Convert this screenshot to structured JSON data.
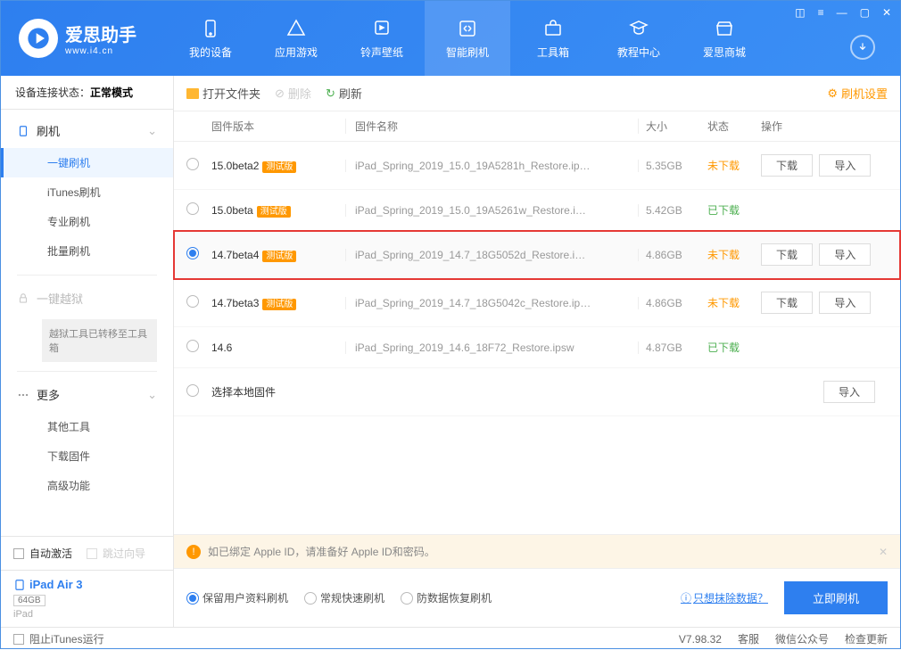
{
  "brand": {
    "name": "爱思助手",
    "url": "www.i4.cn"
  },
  "nav": {
    "items": [
      {
        "label": "我的设备"
      },
      {
        "label": "应用游戏"
      },
      {
        "label": "铃声壁纸"
      },
      {
        "label": "智能刷机"
      },
      {
        "label": "工具箱"
      },
      {
        "label": "教程中心"
      },
      {
        "label": "爱思商城"
      }
    ]
  },
  "status": {
    "prefix": "设备连接状态：",
    "value": "正常模式"
  },
  "sidebar": {
    "flash": {
      "title": "刷机",
      "items": [
        "一键刷机",
        "iTunes刷机",
        "专业刷机",
        "批量刷机"
      ]
    },
    "jailbreak": {
      "title": "一键越狱",
      "note": "越狱工具已转移至工具箱"
    },
    "more": {
      "title": "更多",
      "items": [
        "其他工具",
        "下载固件",
        "高级功能"
      ]
    },
    "auto_activate": "自动激活",
    "skip_guide": "跳过向导",
    "device": {
      "name": "iPad Air 3",
      "capacity": "64GB",
      "type": "iPad"
    },
    "block_itunes": "阻止iTunes运行"
  },
  "toolbar": {
    "open": "打开文件夹",
    "delete": "删除",
    "refresh": "刷新",
    "settings": "刷机设置"
  },
  "table": {
    "headers": {
      "version": "固件版本",
      "name": "固件名称",
      "size": "大小",
      "status": "状态",
      "ops": "操作"
    },
    "beta_tag": "测试版",
    "btns": {
      "download": "下载",
      "import": "导入"
    },
    "status_text": {
      "no": "未下载",
      "yes": "已下载"
    },
    "local": "选择本地固件",
    "rows": [
      {
        "ver": "15.0beta2",
        "beta": true,
        "name": "iPad_Spring_2019_15.0_19A5281h_Restore.ip…",
        "size": "5.35GB",
        "status": "no",
        "selected": false,
        "dl": true,
        "imp": true
      },
      {
        "ver": "15.0beta",
        "beta": true,
        "name": "iPad_Spring_2019_15.0_19A5261w_Restore.i…",
        "size": "5.42GB",
        "status": "yes",
        "selected": false,
        "dl": false,
        "imp": false
      },
      {
        "ver": "14.7beta4",
        "beta": true,
        "name": "iPad_Spring_2019_14.7_18G5052d_Restore.i…",
        "size": "4.86GB",
        "status": "no",
        "selected": true,
        "dl": true,
        "imp": true,
        "highlighted": true
      },
      {
        "ver": "14.7beta3",
        "beta": true,
        "name": "iPad_Spring_2019_14.7_18G5042c_Restore.ip…",
        "size": "4.86GB",
        "status": "no",
        "selected": false,
        "dl": true,
        "imp": true
      },
      {
        "ver": "14.6",
        "beta": false,
        "name": "iPad_Spring_2019_14.6_18F72_Restore.ipsw",
        "size": "4.87GB",
        "status": "yes",
        "selected": false,
        "dl": false,
        "imp": false
      }
    ]
  },
  "alert": "如已绑定 Apple ID，请准备好 Apple ID和密码。",
  "options": {
    "opts": [
      "保留用户资料刷机",
      "常规快速刷机",
      "防数据恢复刷机"
    ],
    "link": "只想抹除数据？",
    "action": "立即刷机"
  },
  "footer": {
    "version": "V7.98.32",
    "service": "客服",
    "wechat": "微信公众号",
    "update": "检查更新"
  }
}
